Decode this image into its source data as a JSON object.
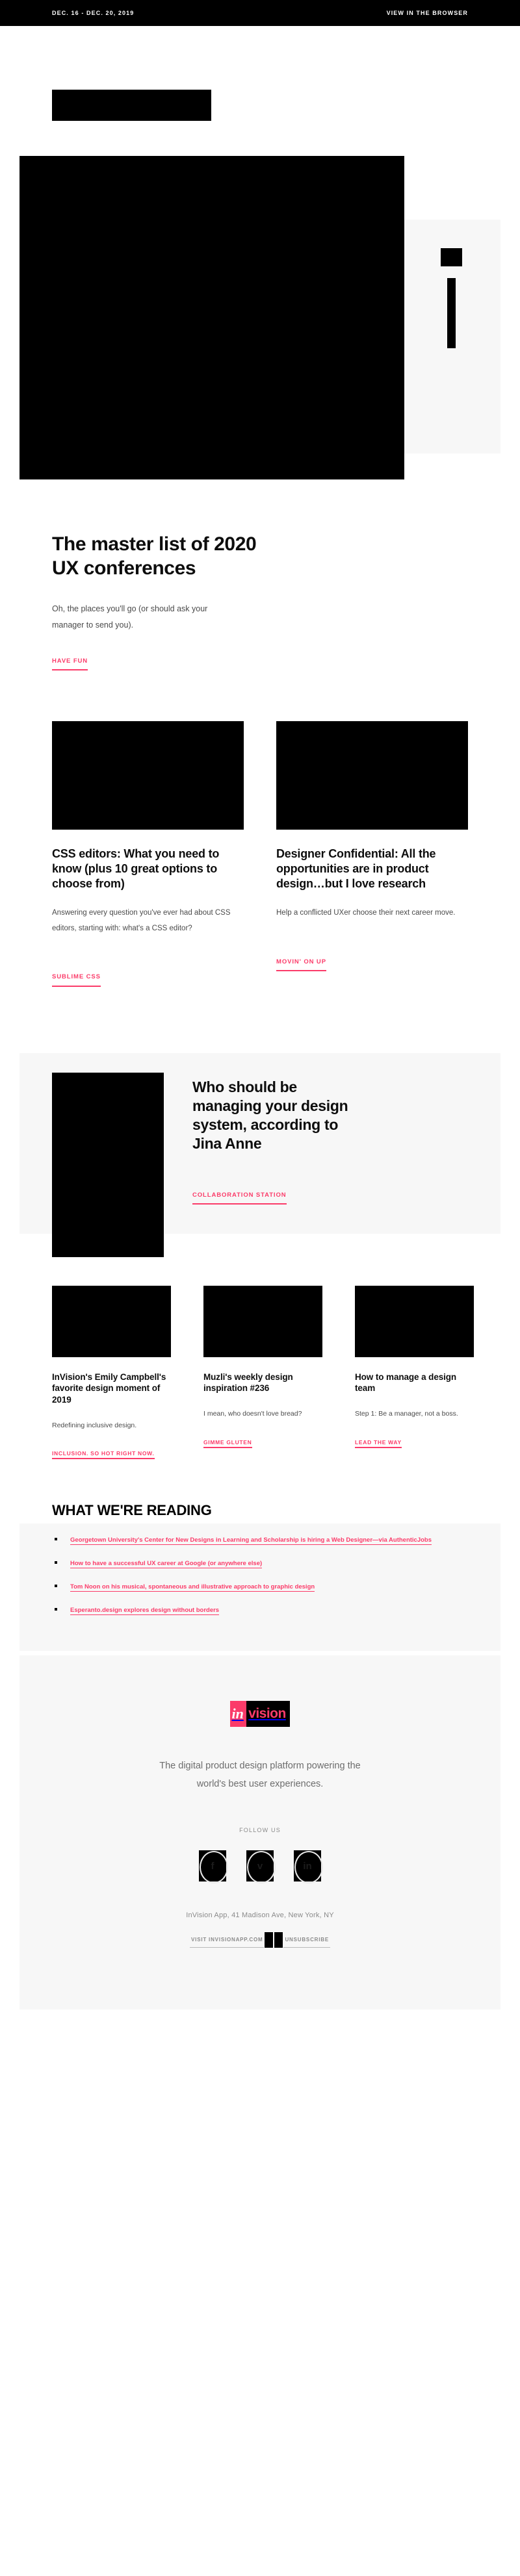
{
  "topbar": {
    "date_range": "DEC. 16 - DEC. 20, 2019",
    "browser_link": "VIEW IN THE BROWSER"
  },
  "brand": {
    "logo_alt": "invision-logo-block",
    "accent_color": "#fb3b69",
    "panel_color": "#f7f7f7"
  },
  "lead": {
    "title": "The master list of 2020 UX conferences",
    "dek": "Oh, the places you'll go (or should ask your manager to send you).",
    "cta": "HAVE FUN"
  },
  "cards_two": [
    {
      "title": "CSS editors: What you need to know (plus 10 great options to choose from)",
      "dek": "Answering every question you've ever had about CSS editors, starting with: what's a CSS editor?",
      "cta": "SUBLIME CSS"
    },
    {
      "title": "Designer Confidential: All the opportunities are in product design…but I love research",
      "dek": "Help a conflicted UXer choose their next career move.",
      "cta": "MOVIN' ON UP"
    }
  ],
  "feature": {
    "title": "Who should be managing your design system, according to Jina Anne",
    "cta": "COLLABORATION STATION"
  },
  "cards_three": [
    {
      "title": "InVision's Emily Campbell's favorite design moment of 2019",
      "dek": "Redefining inclusive design.",
      "cta": "INCLUSION. SO HOT RIGHT NOW."
    },
    {
      "title": "Muzli's weekly design inspiration #236",
      "dek": "I mean, who doesn't love bread?",
      "cta": "GIMME GLUTEN"
    },
    {
      "title": "How to manage a design team",
      "dek": "Step 1: Be a manager, not a boss.",
      "cta": "LEAD THE WAY"
    }
  ],
  "reading": {
    "heading": "WHAT WE'RE READING",
    "links": [
      "Georgetown University's Center for New Designs in Learning and Scholarship is hiring a Web Designer—via AuthenticJobs",
      "How to have a successful UX career at Google (or anywhere else)",
      "Tom Noon on his musical, spontaneous and illustrative approach to graphic design",
      "Esperanto.design explores design without borders"
    ]
  },
  "footer": {
    "logo_in": "in",
    "logo_vision": "vision",
    "tagline": "The digital product design platform powering the world's best user experiences.",
    "follow_label": "FOLLOW US",
    "social": [
      {
        "name": "facebook-icon",
        "glyph": "f"
      },
      {
        "name": "twitter-icon",
        "glyph": "ᴠ"
      },
      {
        "name": "linkedin-icon",
        "glyph": "in"
      }
    ],
    "address": "InVision App, 41 Madison Ave, New York, NY",
    "visit_link": "VISIT INVISIONAPP.COM",
    "unsubscribe_link": "UNSUBSCRIBE"
  }
}
